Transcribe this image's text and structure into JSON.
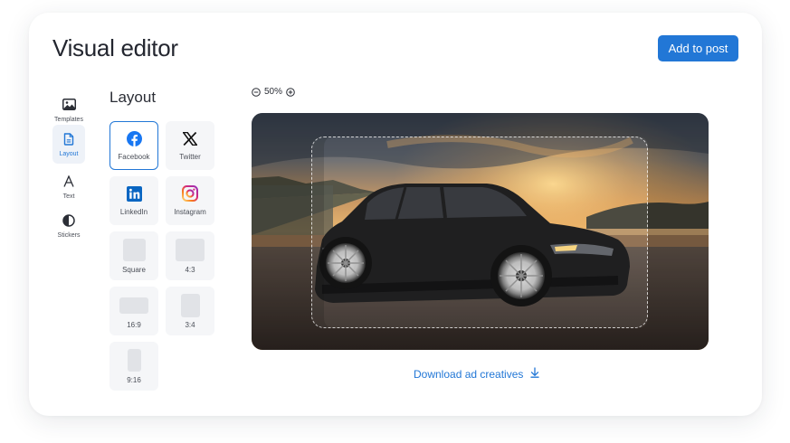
{
  "header": {
    "title": "Visual editor",
    "add_button_label": "Add to post"
  },
  "sidebar": {
    "items": [
      {
        "label": "Templates",
        "icon": "image-icon"
      },
      {
        "label": "Layout",
        "icon": "document-icon",
        "active": true
      },
      {
        "label": "Text",
        "icon": "text-icon"
      },
      {
        "label": "Stickers",
        "icon": "sticker-icon"
      }
    ]
  },
  "layout_panel": {
    "heading": "Layout",
    "options": [
      {
        "label": "Facebook",
        "icon": "facebook-icon",
        "selected": true
      },
      {
        "label": "Twitter",
        "icon": "x-twitter-icon"
      },
      {
        "label": "LinkedIn",
        "icon": "linkedin-icon"
      },
      {
        "label": "Instagram",
        "icon": "instagram-icon"
      },
      {
        "label": "Square",
        "icon": "square-ratio-icon"
      },
      {
        "label": "4:3",
        "icon": "ratio-4-3-icon"
      },
      {
        "label": "16:9",
        "icon": "ratio-16-9-icon"
      },
      {
        "label": "3:4",
        "icon": "ratio-3-4-icon"
      },
      {
        "label": "9:16",
        "icon": "ratio-9-16-icon"
      }
    ]
  },
  "zoom": {
    "level": "50%"
  },
  "download": {
    "label": "Download ad creatives"
  },
  "colors": {
    "accent": "#2277d6",
    "facebook": "#1877f2",
    "linkedin": "#0a66c2",
    "tile_bg": "#f5f6f8"
  }
}
